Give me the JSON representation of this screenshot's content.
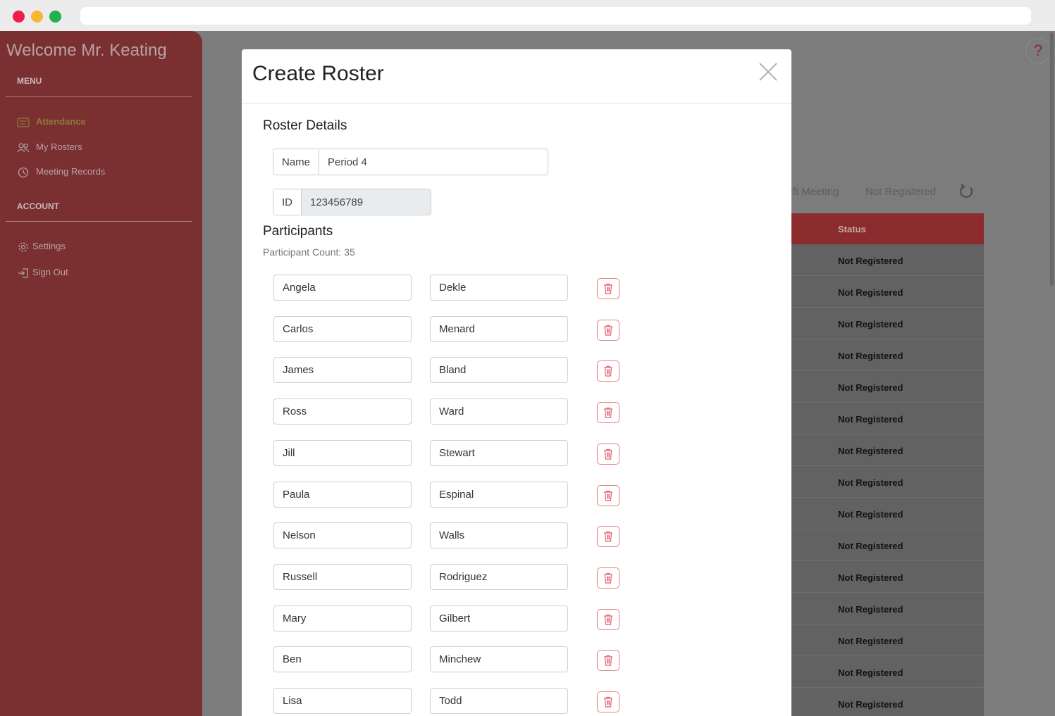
{
  "sidebar": {
    "welcome": "Welcome Mr. Keating",
    "menu_label": "MENU",
    "menu_items": [
      {
        "label": "Attendance",
        "icon": "attendance-icon",
        "active": true
      },
      {
        "label": "My Rosters",
        "icon": "users-icon",
        "active": false
      },
      {
        "label": "Meeting Records",
        "icon": "clock-icon",
        "active": false
      }
    ],
    "account_label": "ACCOUNT",
    "account_items": [
      {
        "label": "Settings",
        "icon": "gear-icon"
      },
      {
        "label": "Sign Out",
        "icon": "sign-out-icon"
      }
    ]
  },
  "background": {
    "filter_left_meeting": "Left Meeting",
    "filter_not_registered": "Not Registered",
    "help": "?",
    "table_header_status": "Status",
    "rows": [
      "Not Registered",
      "Not Registered",
      "Not Registered",
      "Not Registered",
      "Not Registered",
      "Not Registered",
      "Not Registered",
      "Not Registered",
      "Not Registered",
      "Not Registered",
      "Not Registered",
      "Not Registered",
      "Not Registered",
      "Not Registered",
      "Not Registered"
    ]
  },
  "modal": {
    "title": "Create Roster",
    "roster_details_heading": "Roster Details",
    "name_label": "Name",
    "name_value": "Period 4",
    "id_label": "ID",
    "id_value": "123456789",
    "participants_heading": "Participants",
    "participant_count": "Participant Count: 35",
    "participants": [
      {
        "first": "Angela",
        "last": "Dekle"
      },
      {
        "first": "Carlos",
        "last": "Menard"
      },
      {
        "first": "James",
        "last": "Bland"
      },
      {
        "first": "Ross",
        "last": "Ward"
      },
      {
        "first": "Jill",
        "last": "Stewart"
      },
      {
        "first": "Paula",
        "last": "Espinal"
      },
      {
        "first": "Nelson",
        "last": "Walls"
      },
      {
        "first": "Russell",
        "last": "Rodriguez"
      },
      {
        "first": "Mary",
        "last": "Gilbert"
      },
      {
        "first": "Ben",
        "last": "Minchew"
      },
      {
        "first": "Lisa",
        "last": "Todd"
      }
    ]
  },
  "colors": {
    "sidebar": "#7a2f31",
    "table_header": "#8c2b2d",
    "delete_border": "#e7808a"
  }
}
